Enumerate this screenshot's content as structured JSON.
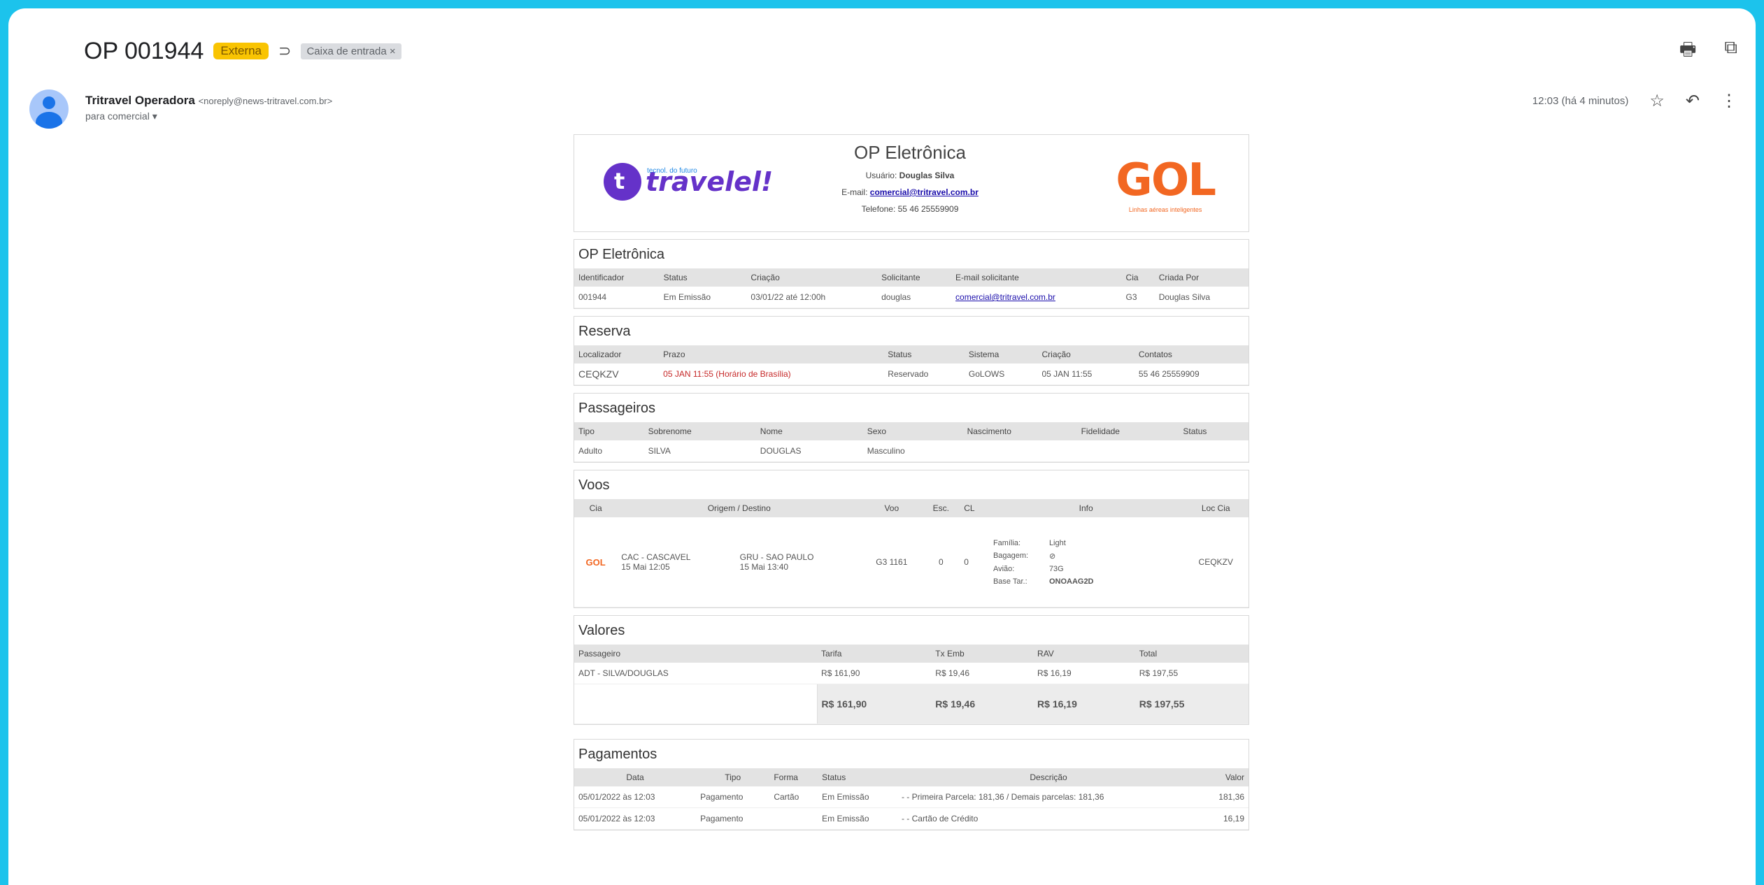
{
  "subject": {
    "title": "OP 001944",
    "external_badge": "Externa",
    "label_icon": "label-icon",
    "inbox_chip": "Caixa de entrada ×"
  },
  "top_icons": {
    "print": "print-icon",
    "open_new": "open-in-new-icon"
  },
  "sender": {
    "name": "Tritravel Operadora",
    "address": "<noreply@news-tritravel.com.br>",
    "to": "para comercial ▾",
    "time": "12:03 (há 4 minutos)"
  },
  "header": {
    "logo_left_text": "travelel!",
    "logo_left_tag": "tecnol. do futuro",
    "title": "OP Eletrônica",
    "user_label": "Usuário:",
    "user": "Douglas Silva",
    "email_label": "E-mail:",
    "email": "comercial@tritravel.com.br",
    "phone": "Telefone: 55 46 25559909",
    "logo_right": "GOL",
    "logo_right_tag": "Linhas aéreas inteligentes"
  },
  "op": {
    "title": "OP Eletrônica",
    "headers": [
      "Identificador",
      "Status",
      "Criação",
      "Solicitante",
      "E-mail solicitante",
      "Cia",
      "Criada Por"
    ],
    "row": [
      "001944",
      "Em Emissão",
      "03/01/22 até 12:00h",
      "douglas",
      "comercial@tritravel.com.br",
      "G3",
      "Douglas Silva"
    ]
  },
  "reserva": {
    "title": "Reserva",
    "headers": [
      "Localizador",
      "Prazo",
      "Status",
      "Sistema",
      "Criação",
      "Contatos"
    ],
    "row": [
      "CEQKZV",
      "05 JAN 11:55 (Horário de Brasília)",
      "Reservado",
      "GoLOWS",
      "05 JAN 11:55",
      "55 46 25559909"
    ]
  },
  "passageiros": {
    "title": "Passageiros",
    "headers": [
      "Tipo",
      "Sobrenome",
      "Nome",
      "Sexo",
      "Nascimento",
      "Fidelidade",
      "Status"
    ],
    "row": [
      "Adulto",
      "SILVA",
      "DOUGLAS",
      "Masculino",
      "",
      "",
      ""
    ]
  },
  "voos": {
    "title": "Voos",
    "headers": [
      "Cia",
      "Origem / Destino",
      "",
      "Voo",
      "Esc.",
      "CL",
      "Info",
      "Loc Cia"
    ],
    "cia": "GOL",
    "origem": "CAC - CASCAVEL",
    "origem_time": "15 Mai 12:05",
    "destino": "GRU - SAO PAULO",
    "destino_time": "15 Mai 13:40",
    "voo": "G3 1161",
    "esc": "0",
    "cl": "0",
    "info": [
      [
        "Família:",
        "Light"
      ],
      [
        "Bagagem:",
        "⊘"
      ],
      [
        "Avião:",
        "73G"
      ],
      [
        "Base Tar.:",
        "ONOAAG2D"
      ]
    ],
    "loc": "CEQKZV"
  },
  "valores": {
    "title": "Valores",
    "headers": [
      "Passageiro",
      "Tarifa",
      "Tx Emb",
      "RAV",
      "Total"
    ],
    "row": [
      "ADT - SILVA/DOUGLAS",
      "R$ 161,90",
      "R$ 19,46",
      "R$ 16,19",
      "R$ 197,55"
    ],
    "totals": [
      "R$ 161,90",
      "R$ 19,46",
      "R$ 16,19",
      "R$ 197,55"
    ]
  },
  "pagamentos": {
    "title": "Pagamentos",
    "headers": [
      "Data",
      "Tipo",
      "Forma",
      "Status",
      "Descrição",
      "Valor"
    ],
    "rows": [
      [
        "05/01/2022 às 12:03",
        "Pagamento",
        "Cartão",
        "Em Emissão",
        "- - Primeira Parcela: 181,36 / Demais parcelas: 181,36",
        "181,36"
      ],
      [
        "05/01/2022 às 12:03",
        "Pagamento",
        "",
        "Em Emissão",
        "- - Cartão de Crédito",
        "16,19"
      ]
    ]
  }
}
